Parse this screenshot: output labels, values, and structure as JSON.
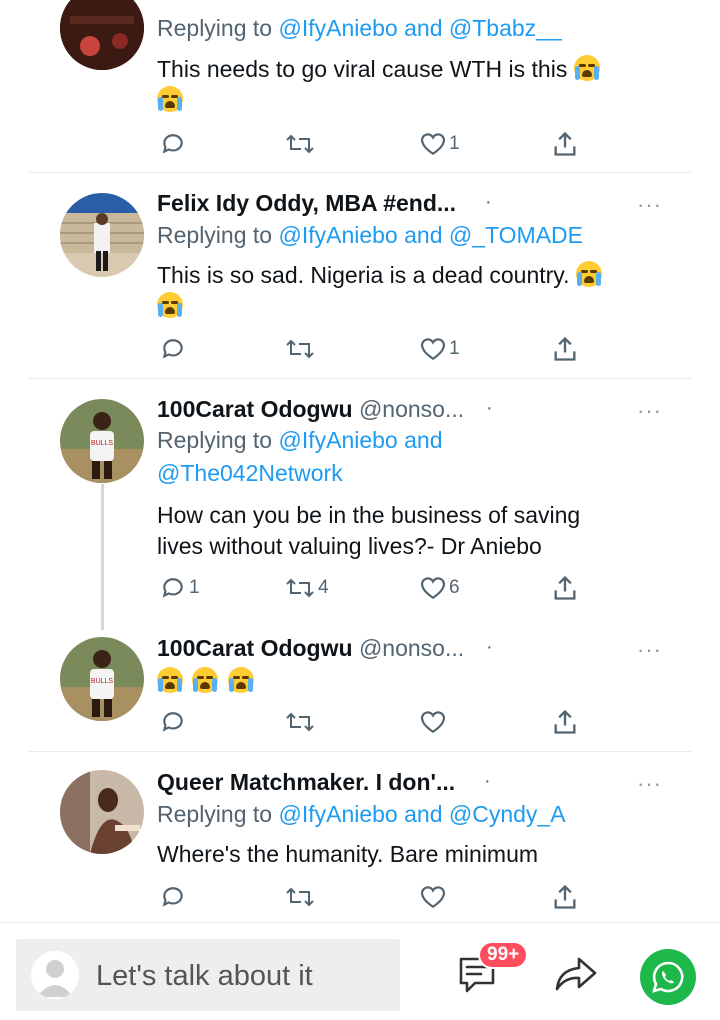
{
  "tweets": [
    {
      "reply_prefix": "Replying to",
      "mention_a": "@IfyAniebo",
      "and": "and",
      "mention_b": "@Tbabz__",
      "text": "This needs to go viral cause WTH is this",
      "reply_count": "",
      "retweet_count": "",
      "like_count": "1"
    },
    {
      "name": "Felix Idy Oddy, MBA #end...",
      "dot": "·",
      "reply_prefix": "Replying to",
      "mention_a": "@IfyAniebo",
      "and": "and",
      "mention_b": "@_TOMADE",
      "text": "This is so sad. Nigeria is a dead country.",
      "like_count": "1"
    },
    {
      "name": "100Carat Odogwu",
      "handle": "@nonso...",
      "dot": "·",
      "reply_prefix": "Replying to",
      "mention_a": "@IfyAniebo",
      "and": "and",
      "mention_b": "@The042Network",
      "text_line1": "How can you be in the business of saving",
      "text_line2": "lives without valuing lives?- Dr Aniebo",
      "reply_count": "1",
      "retweet_count": "4",
      "like_count": "6"
    },
    {
      "name": "100Carat Odogwu",
      "handle": "@nonso...",
      "dot": "·"
    },
    {
      "name": "Queer Matchmaker. I don'...",
      "dot": "·",
      "reply_prefix": "Replying to",
      "mention_a": "@IfyAniebo",
      "and": "and",
      "mention_b": "@Cyndy_A",
      "text": "Where's the humanity. Bare minimum"
    }
  ],
  "more_glyph": "···",
  "bottom_bar": {
    "input_placeholder": "Let's talk about it",
    "comments_badge": "99+"
  },
  "colors": {
    "mention": "#1d9bf0",
    "secondary_text": "#536471",
    "badge": "#ff4d5e",
    "whatsapp": "#1eb84a"
  }
}
